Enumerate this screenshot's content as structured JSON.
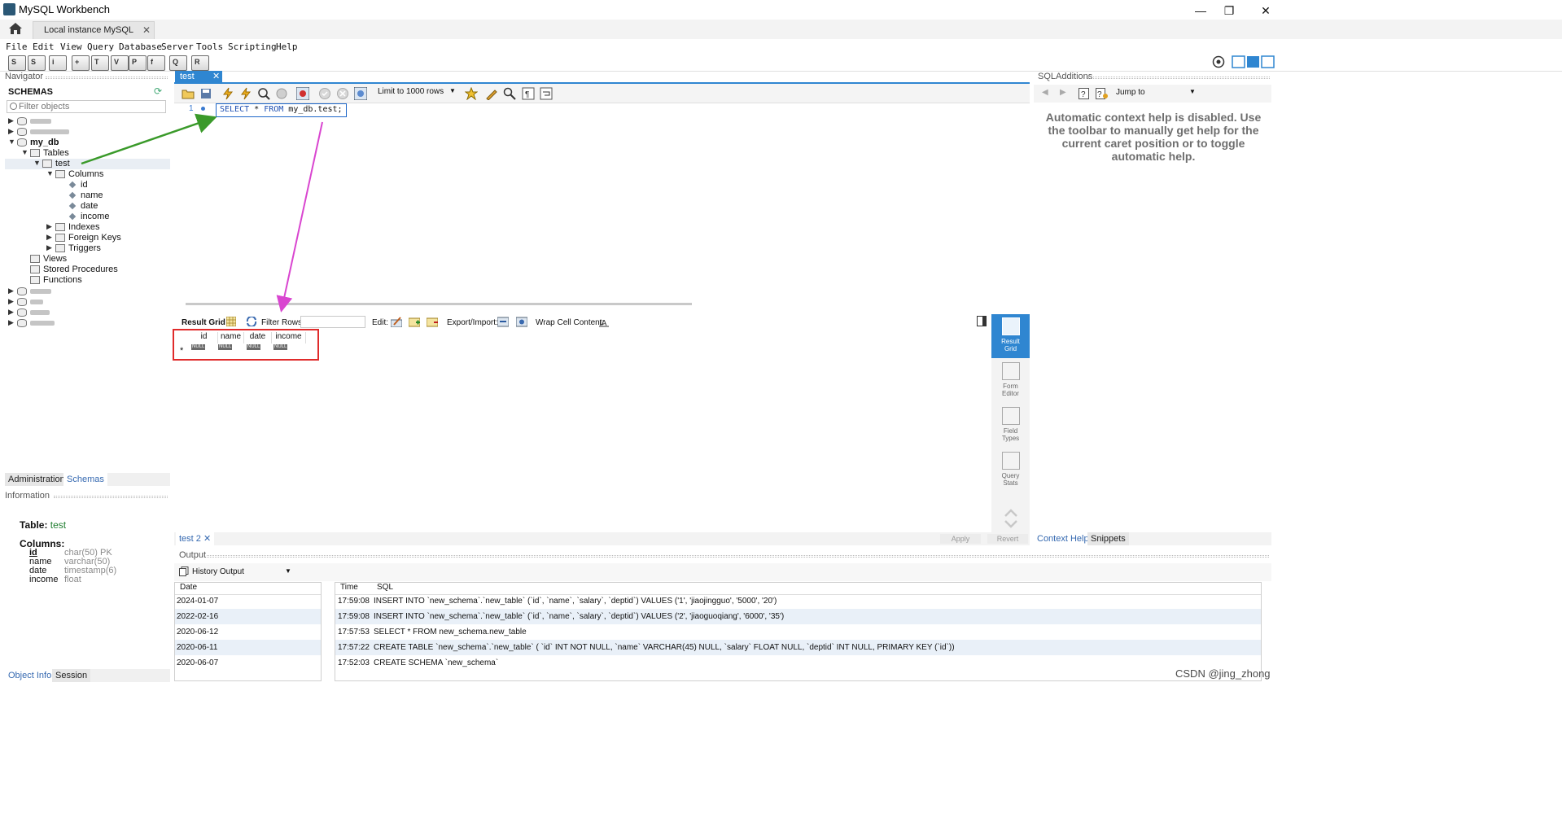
{
  "window": {
    "title": "MySQL Workbench",
    "controls": {
      "minimize": "—",
      "maximize": "❐",
      "close": "✕"
    }
  },
  "connection_tab": {
    "label": "Local instance MySQL",
    "close": "✕"
  },
  "menu": [
    "File",
    "Edit",
    "View",
    "Query",
    "Database",
    "Server",
    "Tools",
    "Scripting",
    "Help"
  ],
  "navigator": {
    "header": "Navigator",
    "schemas_label": "SCHEMAS",
    "filter_placeholder": "Filter objects",
    "tree": {
      "db": "my_db",
      "tables": "Tables",
      "table": "test",
      "columns_folder": "Columns",
      "columns": [
        "id",
        "name",
        "date",
        "income"
      ],
      "indexes": "Indexes",
      "foreign_keys": "Foreign Keys",
      "triggers": "Triggers",
      "views": "Views",
      "stored_procedures": "Stored Procedures",
      "functions": "Functions"
    },
    "bottom_tabs": [
      "Administration",
      "Schemas"
    ]
  },
  "information": {
    "header": "Information",
    "table_label": "Table:",
    "table_name": "test",
    "columns_label": "Columns:",
    "columns": [
      {
        "name": "id",
        "type": "char(50) PK"
      },
      {
        "name": "name",
        "type": "varchar(50)"
      },
      {
        "name": "date",
        "type": "timestamp(6)"
      },
      {
        "name": "income",
        "type": "float"
      }
    ],
    "bottom_tabs": [
      "Object Info",
      "Session"
    ]
  },
  "editor": {
    "tab_label": "test",
    "tab_close": "✕",
    "limit_label": "Limit to 1000 rows",
    "line_number": "1",
    "sql_keyword_select": "SELECT",
    "sql_star": " * ",
    "sql_keyword_from": "FROM",
    "sql_rest": " my_db.test;"
  },
  "result": {
    "grid_label": "Result Grid",
    "filter_label": "Filter Rows:",
    "edit_label": "Edit:",
    "export_label": "Export/Import:",
    "wrap_label": "Wrap Cell Content:",
    "columns": [
      "id",
      "name",
      "date",
      "income"
    ],
    "null_text": "NULL",
    "new_row_marker": "*",
    "side_buttons": [
      {
        "line1": "Result",
        "line2": "Grid"
      },
      {
        "line1": "Form",
        "line2": "Editor"
      },
      {
        "line1": "Field",
        "line2": "Types"
      },
      {
        "line1": "Query",
        "line2": "Stats"
      }
    ],
    "subtab": "test 2",
    "subtab_close": "✕",
    "apply": "Apply",
    "revert": "Revert"
  },
  "output": {
    "header": "Output",
    "selector": "History Output",
    "date_header": "Date",
    "time_header": "Time",
    "sql_header": "SQL",
    "dates": [
      "2024-01-07",
      "2022-02-16",
      "2020-06-12",
      "2020-06-11",
      "2020-06-07"
    ],
    "log": [
      {
        "time": "17:59:08",
        "sql": "INSERT INTO `new_schema`.`new_table` (`id`, `name`, `salary`, `deptid`) VALUES ('1', 'jiaojingguo', '5000', '20')"
      },
      {
        "time": "17:59:08",
        "sql": "INSERT INTO `new_schema`.`new_table` (`id`, `name`, `salary`, `deptid`) VALUES ('2', 'jiaoguoqiang', '6000', '35')"
      },
      {
        "time": "17:57:53",
        "sql": "SELECT * FROM new_schema.new_table"
      },
      {
        "time": "17:57:22",
        "sql": "CREATE TABLE `new_schema`.`new_table` (   `id` INT NOT NULL,   `name` VARCHAR(45) NULL,   `salary` FLOAT NULL,   `deptid` INT NULL,   PRIMARY KEY (`id`))"
      },
      {
        "time": "17:52:03",
        "sql": "CREATE SCHEMA `new_schema`"
      }
    ]
  },
  "sql_additions": {
    "header": "SQLAdditions",
    "jump_to": "Jump to",
    "help_text": "Automatic context help is disabled. Use the toolbar to manually get help for the current caret position or to toggle automatic help.",
    "tabs": [
      "Context Help",
      "Snippets"
    ]
  },
  "watermark": "CSDN @jing_zhong",
  "colors": {
    "accent": "#2f86d1",
    "annotation_green": "#3a9a2a",
    "annotation_magenta": "#d946d0",
    "annotation_red": "#e02b2b"
  }
}
